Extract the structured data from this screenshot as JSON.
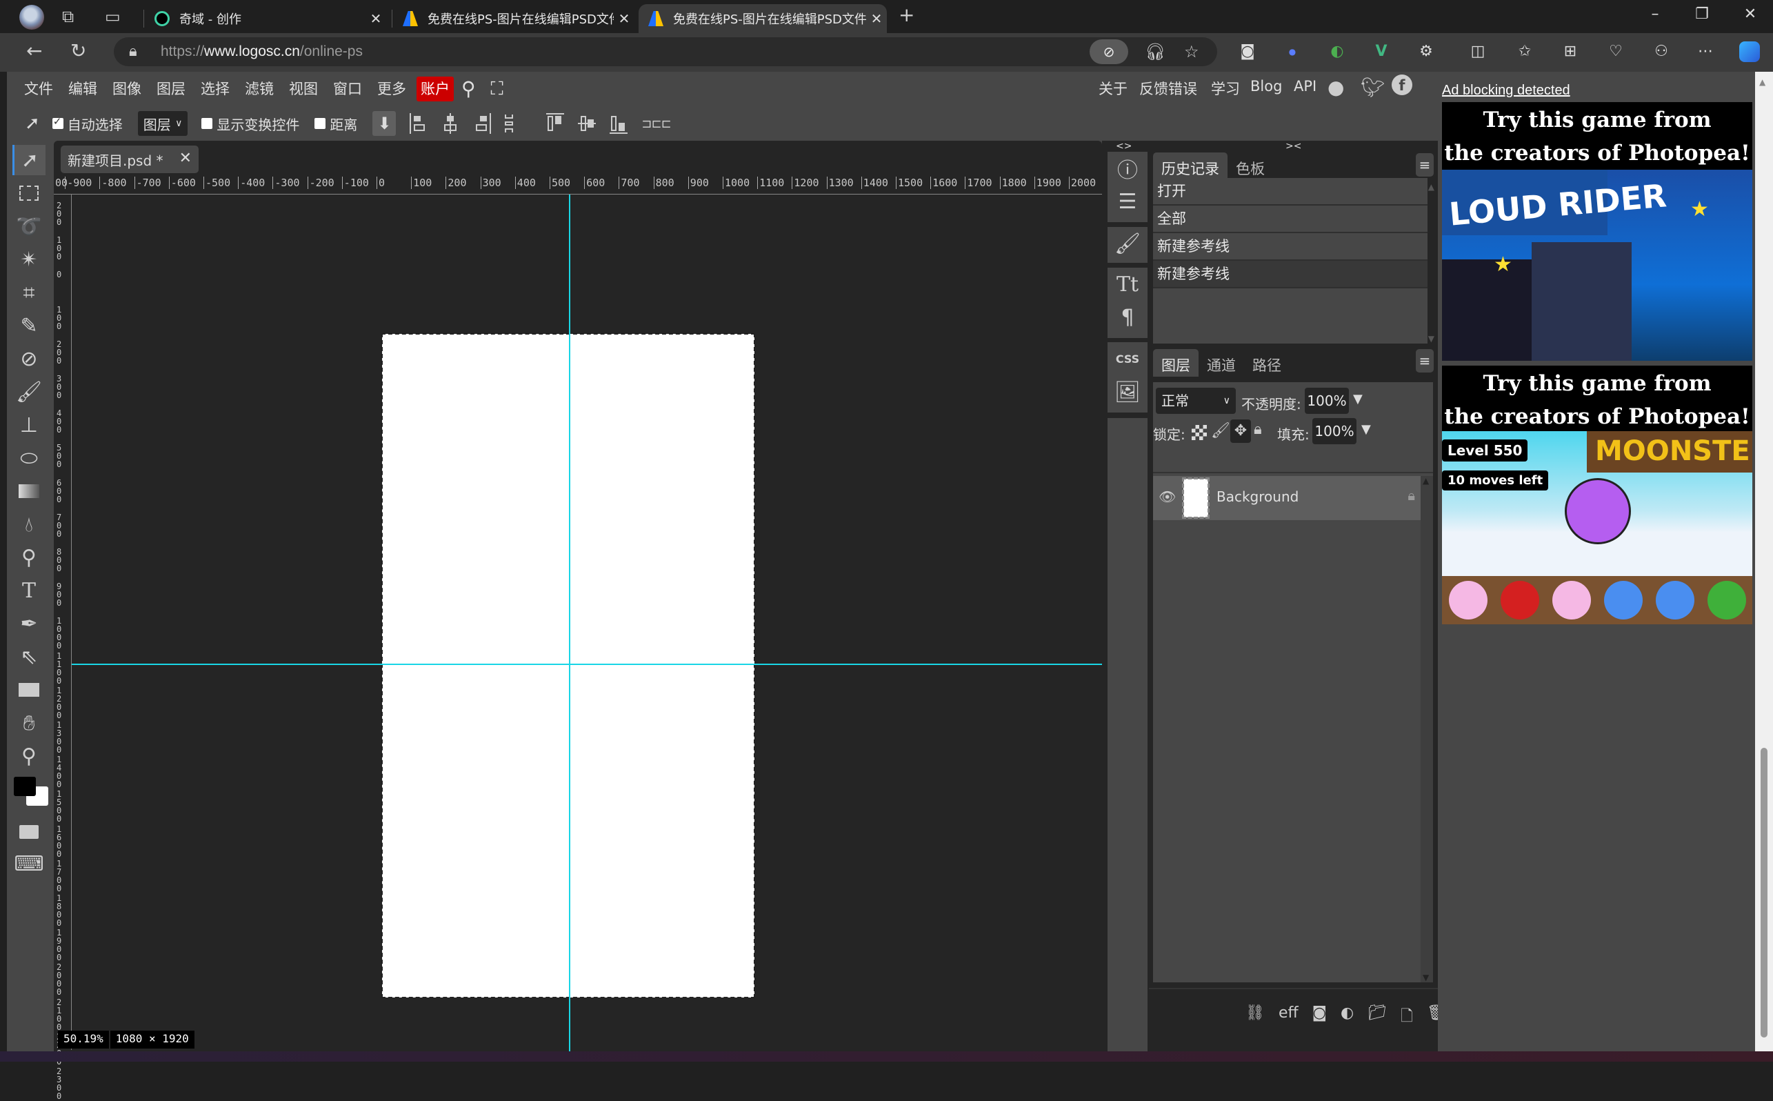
{
  "browser": {
    "tabs": [
      {
        "label": "奇域 - 创作",
        "active": false
      },
      {
        "label": "免费在线PS-图片在线编辑PSD文件",
        "active": false
      },
      {
        "label": "免费在线PS-图片在线编辑PSD文件",
        "active": true
      }
    ],
    "new_tab": "+",
    "url_prefix": "https://",
    "url_domain": "www.logosc.cn",
    "url_path": "/online-ps",
    "window_controls": {
      "minimize": "–",
      "restore": "❐",
      "close": "✕"
    }
  },
  "menubar": {
    "items": [
      "文件",
      "编辑",
      "图像",
      "图层",
      "选择",
      "滤镜",
      "视图",
      "窗口",
      "更多"
    ],
    "account": "账户",
    "right_links": [
      "关于",
      "反馈错误",
      "学习",
      "Blog",
      "API"
    ]
  },
  "options": {
    "auto_select_label": "自动选择",
    "auto_select_checked": true,
    "target_select": "图层",
    "show_transform_label": "显示变换控件",
    "show_transform_checked": false,
    "distance_label": "距离",
    "distance_checked": false
  },
  "document": {
    "tab_name": "新建项目.psd *",
    "zoom": "50.19%",
    "width": "1080",
    "times": "×",
    "height": "1920",
    "hruler_labels": [
      "00",
      "-900",
      "-800",
      "-700",
      "-600",
      "-500",
      "-400",
      "-300",
      "-200",
      "-100",
      "0",
      "100",
      "200",
      "300",
      "400",
      "500",
      "600",
      "700",
      "800",
      "900",
      "1000",
      "1100",
      "1200",
      "1300",
      "1400",
      "1500",
      "1600",
      "1700",
      "1800",
      "1900",
      "2000"
    ],
    "vruler_labels": [
      "200",
      "100",
      "0",
      "100",
      "200",
      "300",
      "400",
      "500",
      "600",
      "700",
      "800",
      "900",
      "1000",
      "1100",
      "1200",
      "1300",
      "1400",
      "1500",
      "1600",
      "1700",
      "1800",
      "1900",
      "2000",
      "2100",
      "2200",
      "2300"
    ]
  },
  "side_collapse": {
    "left": "<>",
    "right": "><"
  },
  "history_panel": {
    "tabs": [
      "历史记录",
      "色板"
    ],
    "items": [
      "打开",
      "全部",
      "新建参考线",
      "新建参考线"
    ]
  },
  "layers_panel": {
    "tabs": [
      "图层",
      "通道",
      "路径"
    ],
    "blend_mode": "正常",
    "opacity_label": "不透明度:",
    "opacity": "100%",
    "lock_label": "锁定:",
    "fill_label": "填充:",
    "fill": "100%",
    "layers": [
      {
        "name": "Background",
        "visible": true,
        "locked": true
      }
    ],
    "footer_eff": "eff"
  },
  "ads": {
    "notice": "Ad blocking detected",
    "ad1": {
      "title_line1": "Try this game from",
      "title_line2": "the creators of Photopea!",
      "game": "LOUD RIDER"
    },
    "ad2": {
      "title_line1": "Try this game from",
      "title_line2": "the creators of Photopea!",
      "game": "MOONSTERS",
      "level": "Level 550",
      "moves": "10 moves left"
    }
  }
}
